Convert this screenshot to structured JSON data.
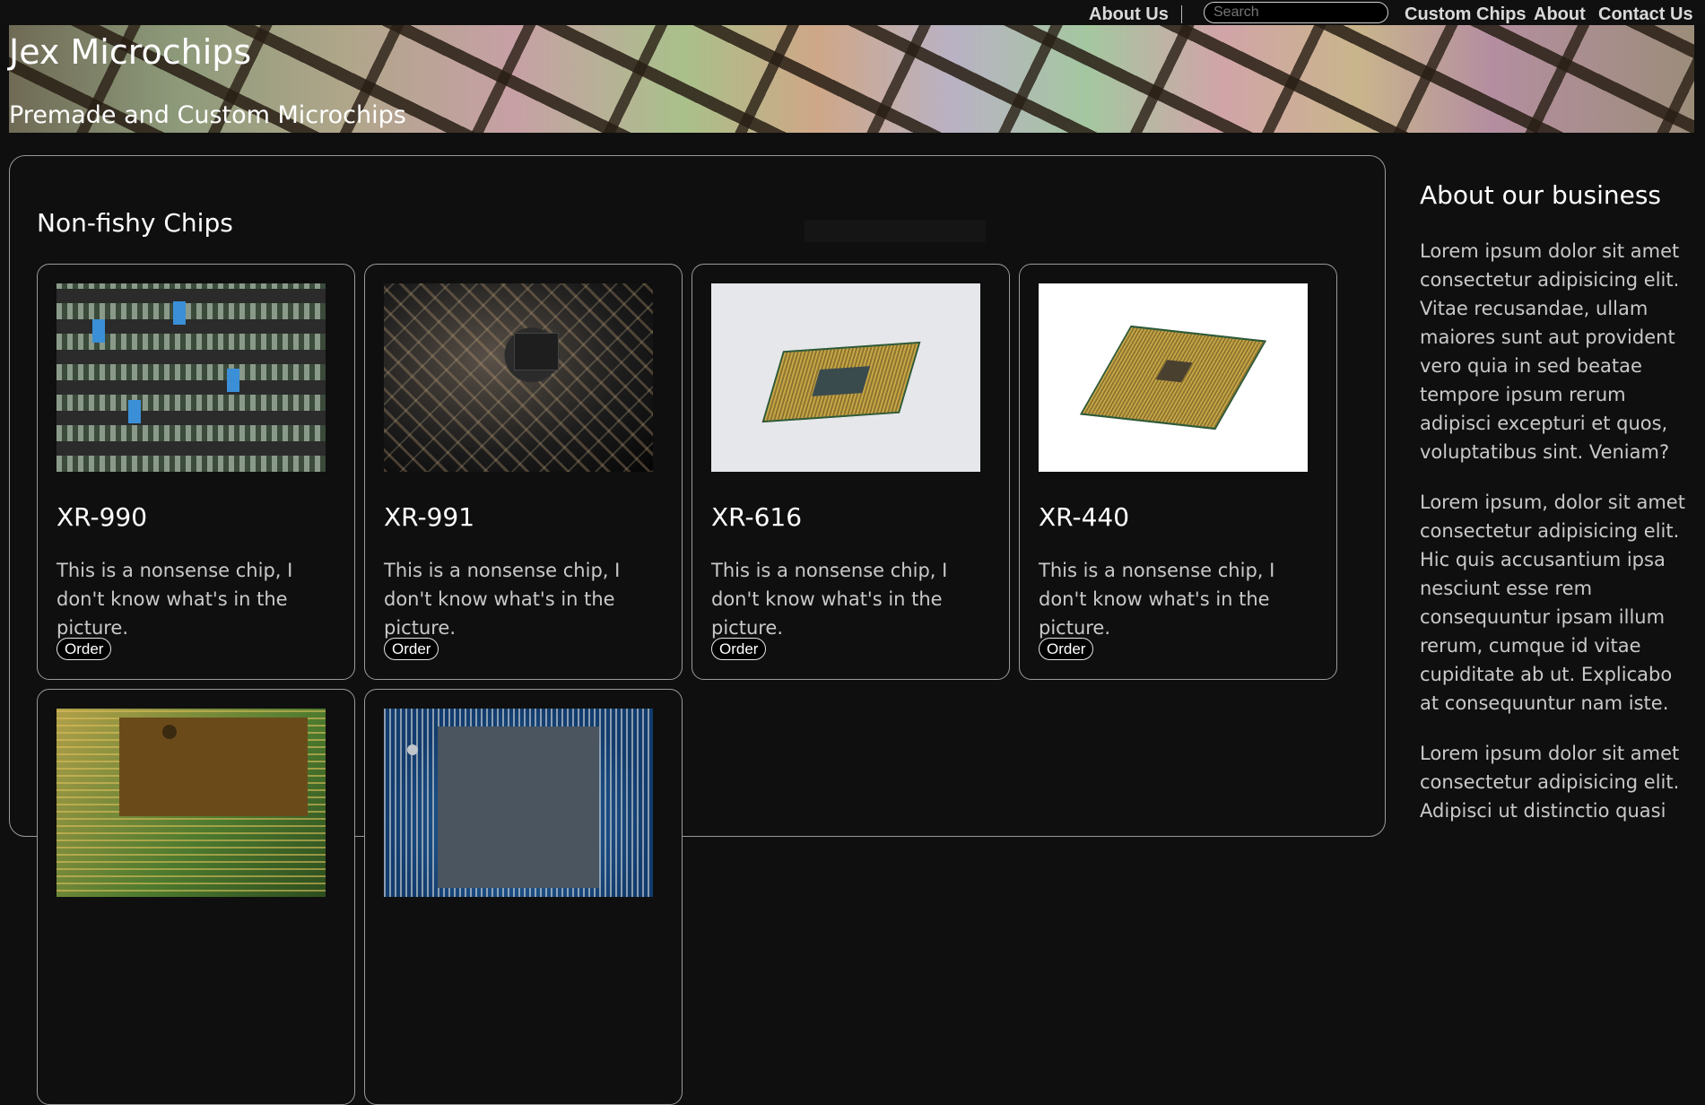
{
  "nav": {
    "about_us": "About Us",
    "search_placeholder": "Search",
    "custom_chips": "Custom Chips",
    "about": "About",
    "contact_us": "Contact Us"
  },
  "banner": {
    "title": "Jex Microchips",
    "subtitle": "Premade and Custom Microchips"
  },
  "main": {
    "section_title": "Non-fishy Chips",
    "products": [
      {
        "name": "XR-990",
        "description": "This is a nonsense chip, I don't know what's in the picture.",
        "order_label": "Order",
        "image": "pcb-green-components"
      },
      {
        "name": "XR-991",
        "description": "This is a nonsense chip, I don't know what's in the picture.",
        "order_label": "Order",
        "image": "pcb-dark-closeup"
      },
      {
        "name": "XR-616",
        "description": "This is a nonsense chip, I don't know what's in the picture.",
        "order_label": "Order",
        "image": "cpu-on-gray"
      },
      {
        "name": "XR-440",
        "description": "This is a nonsense chip, I don't know what's in the picture.",
        "order_label": "Order",
        "image": "cpu-on-white"
      },
      {
        "name": "",
        "description": "",
        "order_label": "",
        "image": "pcb-gold-chip"
      },
      {
        "name": "",
        "description": "",
        "order_label": "",
        "image": "pcb-blue-atmel"
      }
    ]
  },
  "sidebar": {
    "title": "About our business",
    "paragraphs": [
      "Lorem ipsum dolor sit amet consectetur adipisicing elit. Vitae recusandae, ullam maiores sunt aut provident vero quia in sed beatae tempore ipsum rerum adipisci excepturi et quos, voluptatibus sint. Veniam?",
      "Lorem ipsum, dolor sit amet consectetur adipisicing elit. Hic quis accusantium ipsa nesciunt esse rem consequuntur ipsam illum rerum, cumque id vitae cupiditate ab ut. Explicabo at consequuntur nam iste.",
      "Lorem ipsum dolor sit amet consectetur adipisicing elit. Adipisci ut distinctio quasi"
    ]
  },
  "colors": {
    "background": "#0f0f0f",
    "border": "#9a9a9a",
    "text": "#ffffff",
    "muted_text": "#c9c9c9"
  }
}
